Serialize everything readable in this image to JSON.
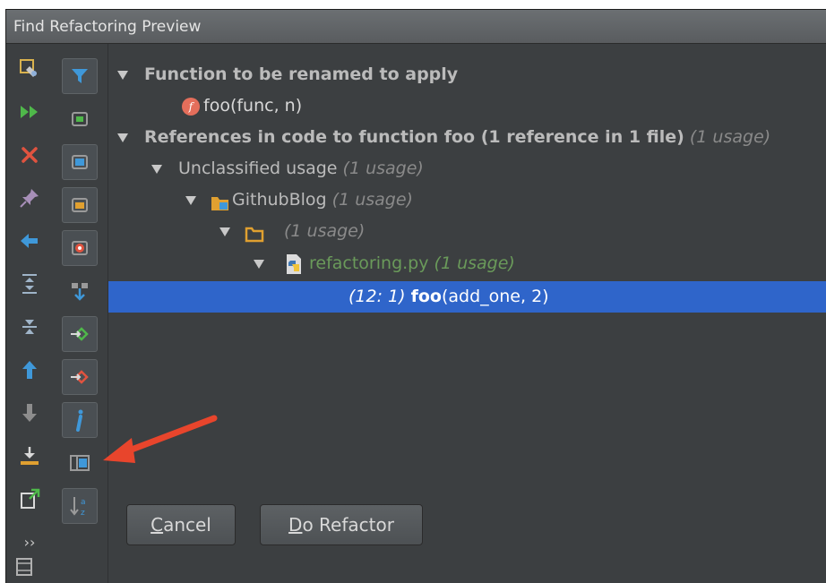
{
  "window": {
    "title": "Find Refactoring Preview"
  },
  "colors": {
    "background": "#3c3f41",
    "selection": "#2f65ca",
    "accent_green": "#6a9a5a",
    "annotation_arrow": "#e8452c"
  },
  "toolbar_left": [
    {
      "icon": "refresh-preview-icon"
    },
    {
      "icon": "rerun-icon"
    },
    {
      "icon": "close-icon"
    },
    {
      "icon": "pin-icon"
    },
    {
      "icon": "back-icon"
    },
    {
      "icon": "expand-all-icon"
    },
    {
      "icon": "collapse-all-icon"
    },
    {
      "icon": "previous-occurrence-icon"
    },
    {
      "icon": "next-occurrence-icon"
    },
    {
      "icon": "export-icon"
    },
    {
      "icon": "open-in-new-tab-icon"
    },
    {
      "icon": "more-icon",
      "label": "››"
    }
  ],
  "toolbar_right": [
    {
      "icon": "filter-icon"
    },
    {
      "icon": "group-by-usage-type-icon"
    },
    {
      "icon": "group-by-module-icon"
    },
    {
      "icon": "group-by-package-icon"
    },
    {
      "icon": "group-by-file-structure-icon"
    },
    {
      "icon": "merge-duplicate-lines-icon"
    },
    {
      "icon": "show-read-access-icon"
    },
    {
      "icon": "show-write-access-icon"
    },
    {
      "icon": "show-info-icon"
    },
    {
      "icon": "preview-usages-icon"
    },
    {
      "icon": "sort-alphabetically-icon"
    }
  ],
  "tree": {
    "root1": {
      "label": "Function to be renamed to apply",
      "child": {
        "name": "foo(func, n)",
        "icon_letter": "f"
      }
    },
    "root2": {
      "label": "References in code to function foo (1 reference in 1 file)",
      "usage": "(1 usage)"
    },
    "group": {
      "label": "Unclassified usage",
      "usage": "(1 usage)"
    },
    "module": {
      "label": "GithubBlog",
      "usage": "(1 usage)"
    },
    "directory": {
      "usage": "(1 usage)"
    },
    "file": {
      "label": "refactoring.py",
      "usage": "(1 usage)"
    },
    "occurrence": {
      "location": "(12: 1)",
      "match": "foo",
      "rest": "(add_one, 2)"
    }
  },
  "buttons": {
    "cancel": {
      "mnemonic": "C",
      "rest": "ancel"
    },
    "do_refactor": {
      "mnemonic": "D",
      "rest": "o Refactor"
    }
  }
}
